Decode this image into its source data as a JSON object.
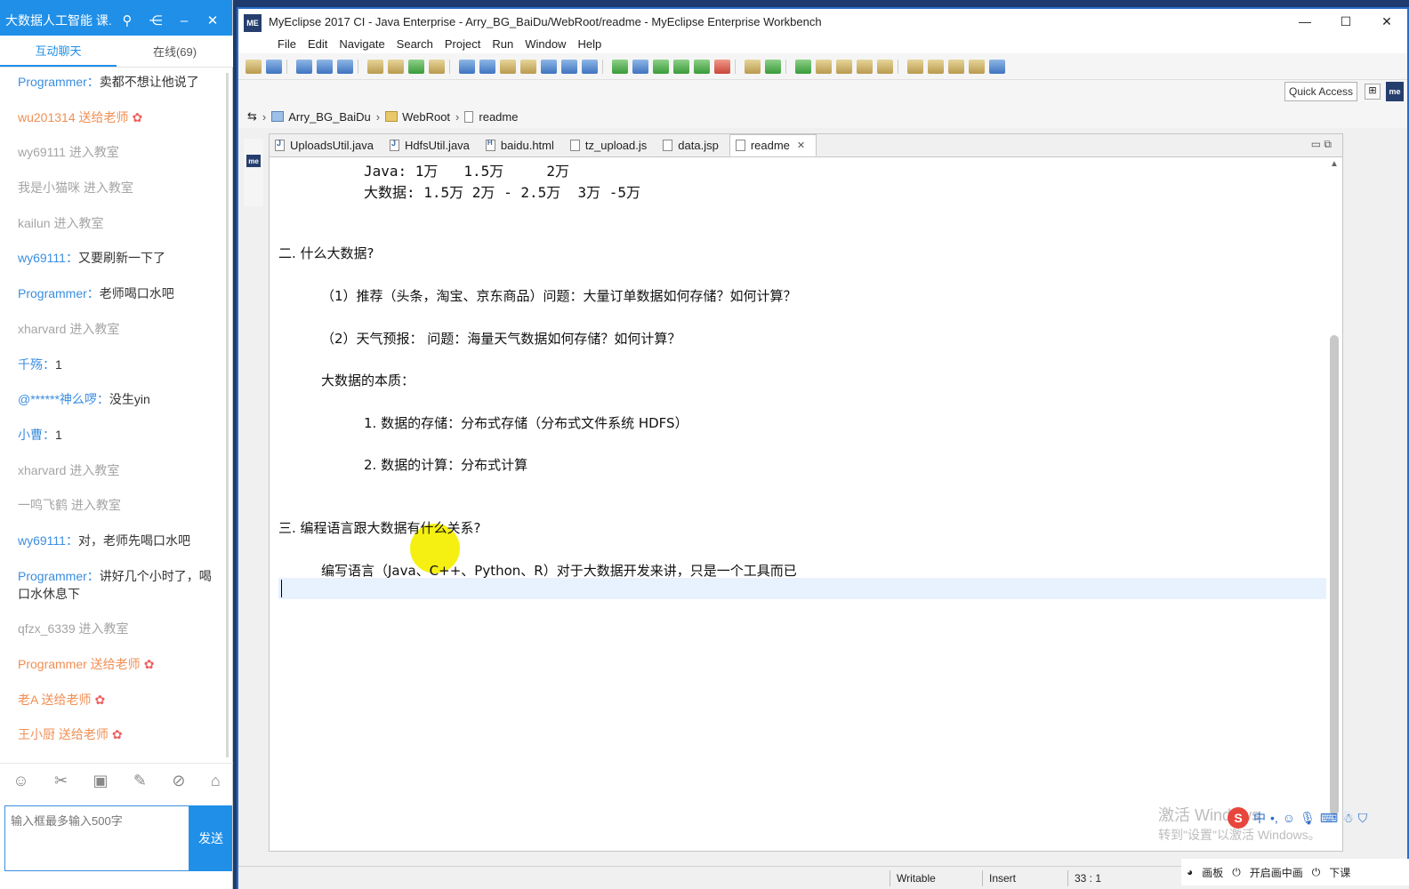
{
  "chat": {
    "title": "大数据人工智能 课...",
    "tabs": [
      "互动聊天",
      "在线(69)"
    ],
    "messages": [
      {
        "user": "Programmer",
        "text": "卖都不想让他说了",
        "kind": "chat"
      },
      {
        "user": "",
        "text": "wu201314 送给老师",
        "kind": "gift"
      },
      {
        "user": "",
        "text": "wy69111 进入教室",
        "kind": "sys"
      },
      {
        "user": "",
        "text": "我是小猫咪 进入教室",
        "kind": "sys"
      },
      {
        "user": "",
        "text": "kailun 进入教室",
        "kind": "sys"
      },
      {
        "user": "wy69111",
        "text": "又要刷新一下了",
        "kind": "chat"
      },
      {
        "user": "Programmer",
        "text": "老师喝口水吧",
        "kind": "chat"
      },
      {
        "user": "",
        "text": "xharvard 进入教室",
        "kind": "sys"
      },
      {
        "user": "千殇",
        "text": "1",
        "kind": "chat"
      },
      {
        "user": "@******神么啰",
        "text": "没生yin",
        "kind": "chat"
      },
      {
        "user": "小曹",
        "text": "1",
        "kind": "chat"
      },
      {
        "user": "",
        "text": "xharvard 进入教室",
        "kind": "sys"
      },
      {
        "user": "",
        "text": "一鸣飞鹤 进入教室",
        "kind": "sys"
      },
      {
        "user": "wy69111",
        "text": "对，老师先喝口水吧",
        "kind": "chat"
      },
      {
        "user": "Programmer",
        "text": "讲好几个小时了，喝口水休息下",
        "kind": "chat"
      },
      {
        "user": "",
        "text": "qfzx_6339 进入教室",
        "kind": "sys"
      },
      {
        "user": "",
        "text": "Programmer 送给老师",
        "kind": "gift"
      },
      {
        "user": "",
        "text": "老A 送给老师",
        "kind": "gift"
      },
      {
        "user": "",
        "text": "王小厨 送给老师",
        "kind": "gift"
      }
    ],
    "input_placeholder": "输入框最多输入500字",
    "send_label": "发送"
  },
  "ide": {
    "title": "MyEclipse 2017 CI - Java Enterprise - Arry_BG_BaiDu/WebRoot/readme - MyEclipse Enterprise Workbench",
    "menu": [
      "File",
      "Edit",
      "Navigate",
      "Search",
      "Project",
      "Run",
      "Window",
      "Help"
    ],
    "quick_access": "Quick Access",
    "breadcrumb": [
      "Arry_BG_BaiDu",
      "WebRoot",
      "readme"
    ],
    "tabs": [
      {
        "label": "UploadsUtil.java",
        "icon": "j",
        "active": false
      },
      {
        "label": "HdfsUtil.java",
        "icon": "j",
        "active": false
      },
      {
        "label": "baidu.html",
        "icon": "h",
        "active": false
      },
      {
        "label": "tz_upload.js",
        "icon": "",
        "active": false
      },
      {
        "label": "data.jsp",
        "icon": "",
        "active": false
      },
      {
        "label": "readme",
        "icon": "",
        "active": true
      }
    ],
    "doc": {
      "l1": "Java: 1万   1.5万     2万",
      "l2": "大数据: 1.5万 2万 - 2.5万  3万 -5万",
      "l3": "二. 什么大数据?",
      "l4": "（1）推荐（头条，淘宝、京东商品）问题：大量订单数据如何存储？如何计算？",
      "l5": "（2）天气预报： 问题：海量天气数据如何存储？如何计算？",
      "l6": "大数据的本质：",
      "l7": "1. 数据的存储：分布式存储（分布式文件系统 HDFS）",
      "l8": "2. 数据的计算：分布式计算",
      "l9": "三. 编程语言跟大数据有什么关系?",
      "l10": "编写语言（Java、C++、Python、R）对于大数据开发来讲，只是一个工具而已"
    },
    "status": {
      "writable": "Writable",
      "insert": "Insert",
      "position": "33 : 1"
    }
  },
  "overlay": {
    "watermark_line1": "激活 Windows",
    "watermark_line2": "转到\"设置\"以激活 Windows。",
    "tray_items": [
      "画板",
      "开启画中画",
      "下课"
    ]
  }
}
